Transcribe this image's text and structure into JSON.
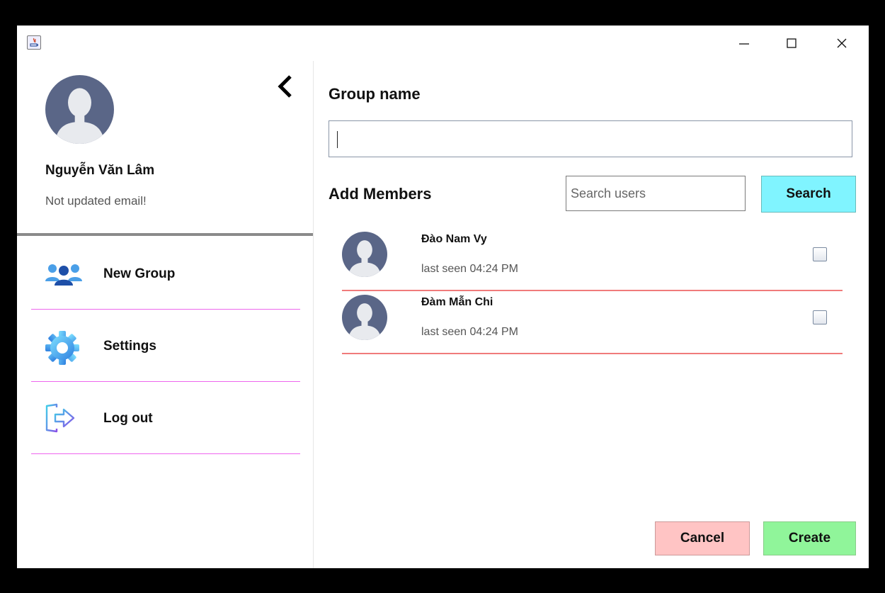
{
  "window": {
    "minimize_glyph": "—",
    "maximize_glyph": "☐",
    "close_glyph": "✕"
  },
  "sidebar": {
    "user": {
      "name": "Nguyễn Văn Lâm",
      "email": "Not updated email!"
    },
    "back_icon": "chevron-left-icon",
    "menu": [
      {
        "label": "New Group",
        "icon": "group-icon"
      },
      {
        "label": "Settings",
        "icon": "gear-icon"
      },
      {
        "label": "Log out",
        "icon": "logout-icon"
      }
    ]
  },
  "form": {
    "group_name_label": "Group name",
    "group_name_value": "",
    "add_members_label": "Add Members",
    "search_placeholder": "Search users",
    "search_button": "Search"
  },
  "members": [
    {
      "name": "Đào Nam Vy",
      "last_seen": "last seen 04:24 PM",
      "checked": false
    },
    {
      "name": "Đàm Mẫn Chi",
      "last_seen": "last seen 04:24 PM",
      "checked": false
    }
  ],
  "actions": {
    "cancel": "Cancel",
    "create": "Create"
  },
  "colors": {
    "avatar_bg": "#5a6687",
    "search_button_bg": "#80f4ff",
    "cancel_bg": "#ffc4c4",
    "create_bg": "#90f59a",
    "menu_divider": "#ee66ee",
    "member_divider": "#f07b7b"
  }
}
